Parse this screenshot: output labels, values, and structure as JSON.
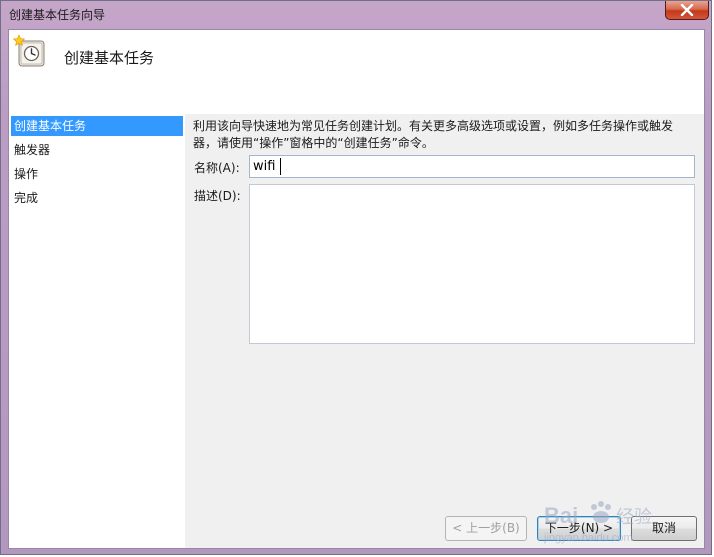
{
  "window": {
    "title": "创建基本任务向导"
  },
  "header": {
    "title": "创建基本任务"
  },
  "sidebar": {
    "steps": [
      {
        "label": "创建基本任务"
      },
      {
        "label": "触发器"
      },
      {
        "label": "操作"
      },
      {
        "label": "完成"
      }
    ]
  },
  "form": {
    "description_line1": "利用该向导快速地为常见任务创建计划。有关更多高级选项或设置，例如多任务操作或触发",
    "description_line2": "器，请使用“操作”窗格中的“创建任务”命令。",
    "name_label": "名称(A):",
    "name_value": "wifi",
    "desc_label": "描述(D):",
    "desc_value": ""
  },
  "buttons": {
    "back": "< 上一步(B)",
    "next": "下一步(N) >",
    "cancel": "取消"
  },
  "watermark": {
    "brand": "Bai",
    "suffix": "经验",
    "url": "jingyan.baidu.com"
  },
  "colors": {
    "selection": "#3399ff",
    "close_button": "#c3391c",
    "titlebar": "#c5a6c9"
  }
}
